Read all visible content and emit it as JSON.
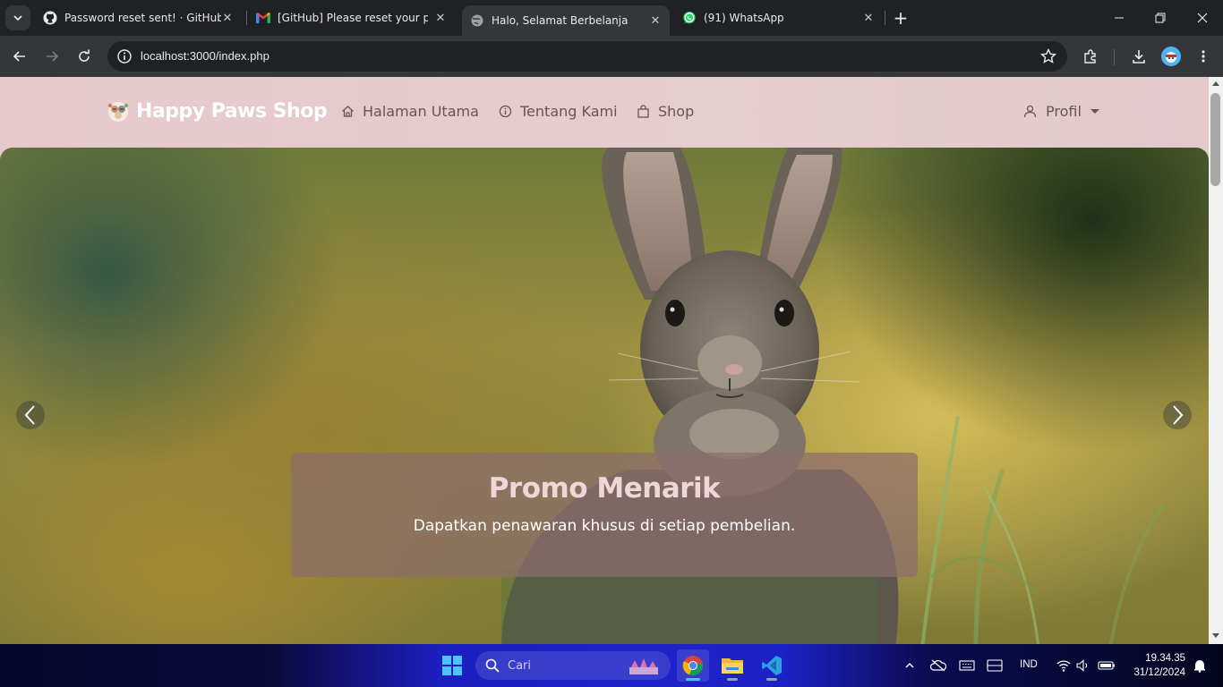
{
  "browser": {
    "tabs": [
      {
        "title": "Password reset sent! · GitHub",
        "icon": "github-icon",
        "active": false
      },
      {
        "title": "[GitHub] Please reset your password",
        "icon": "gmail-icon",
        "active": false
      },
      {
        "title": "Halo, Selamat Berbelanja",
        "icon": "globe-icon",
        "active": true
      },
      {
        "title": "(91) WhatsApp",
        "icon": "whatsapp-icon",
        "active": false
      }
    ],
    "url": "localhost:3000/index.php"
  },
  "site": {
    "brand": "Happy Paws Shop",
    "nav": [
      {
        "label": "Halaman Utama",
        "icon": "home-icon"
      },
      {
        "label": "Tentang Kami",
        "icon": "info-icon"
      },
      {
        "label": "Shop",
        "icon": "shopping-bag-icon"
      }
    ],
    "profile_label": "Profil",
    "colors": {
      "navbar": "#e6cbcd",
      "nav_text": "#6a5355",
      "caption_bg": "#8c6e6e",
      "caption_title": "#efd6d7"
    }
  },
  "carousel": {
    "caption_title": "Promo Menarik",
    "caption_text": "Dapatkan penawaran khusus di setiap pembelian."
  },
  "taskbar": {
    "search_placeholder": "Cari",
    "apps": [
      "chrome-icon",
      "file-explorer-icon",
      "vscode-icon"
    ],
    "language": "IND",
    "time": "19.34.35",
    "date": "31/12/2024"
  }
}
